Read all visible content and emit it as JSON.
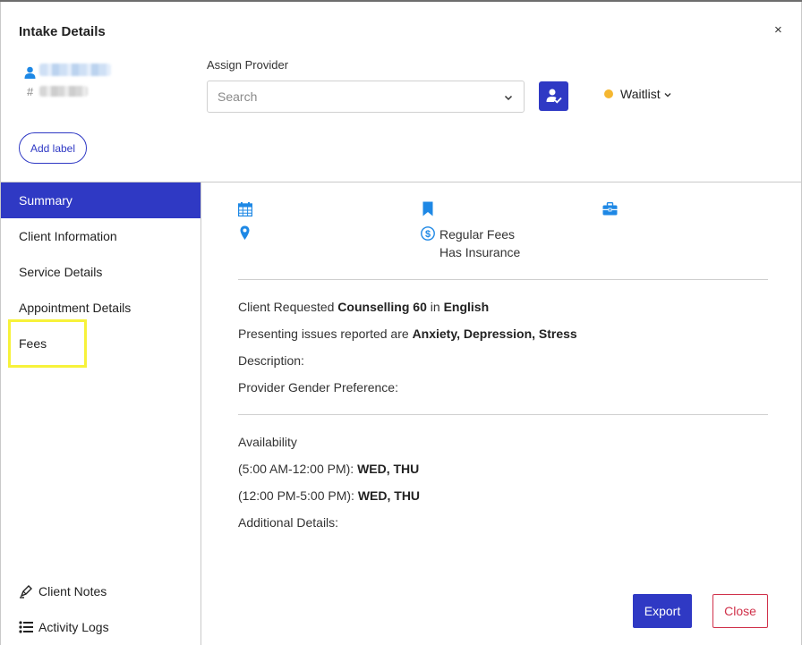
{
  "header": {
    "title": "Intake Details",
    "close_glyph": "×",
    "client_hash": "#"
  },
  "provider": {
    "label": "Assign Provider",
    "search_placeholder": "Search"
  },
  "status": {
    "value": "Waitlist",
    "dot_color": "#f5b731"
  },
  "labels": {
    "add_label": "Add label"
  },
  "sidebar": {
    "items": [
      {
        "label": "Summary",
        "active": true
      },
      {
        "label": "Client Information",
        "active": false
      },
      {
        "label": "Service Details",
        "active": false
      },
      {
        "label": "Appointment Details",
        "active": false
      },
      {
        "label": "Fees",
        "active": false
      }
    ],
    "footer": [
      {
        "label": "Client Notes",
        "icon": "pen-icon"
      },
      {
        "label": "Activity Logs",
        "icon": "list-icon"
      }
    ]
  },
  "summary": {
    "fee_type": "Regular Fees",
    "insurance": "Has Insurance",
    "request_prefix": "Client Requested",
    "service": "Counselling 60",
    "in_word": "in",
    "language": "English",
    "issues_prefix": "Presenting issues reported are",
    "issues": "Anxiety, Depression, Stress",
    "description_label": "Description:",
    "gender_pref_label": "Provider Gender Preference:",
    "availability_title": "Availability",
    "slots": [
      {
        "time": "(5:00 AM-12:00 PM):",
        "days": "WED, THU"
      },
      {
        "time": "(12:00 PM-5:00 PM):",
        "days": "WED, THU"
      }
    ],
    "additional_label": "Additional Details:"
  },
  "actions": {
    "export": "Export",
    "close": "Close"
  },
  "colors": {
    "primary": "#2f39c4",
    "danger": "#d0314a",
    "icon_blue": "#1e88e5",
    "highlight": "#f7f23a"
  }
}
